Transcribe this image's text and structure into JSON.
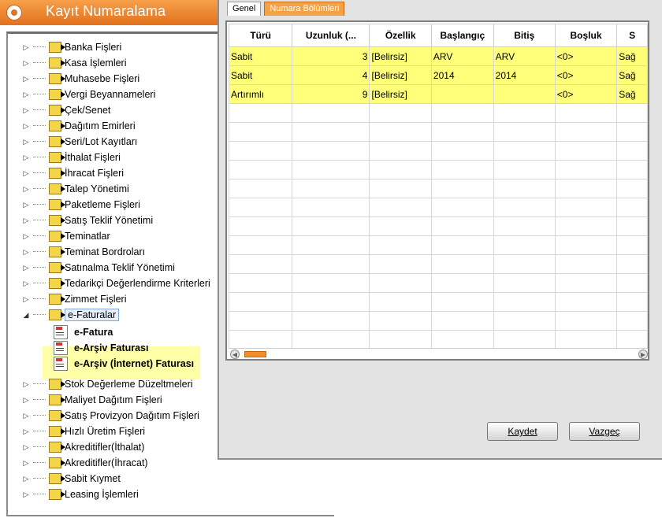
{
  "window": {
    "title": "Kayıt Numaralama"
  },
  "tree": {
    "items": [
      {
        "label": "Banka Fişleri"
      },
      {
        "label": "Kasa İşlemleri"
      },
      {
        "label": "Muhasebe Fişleri"
      },
      {
        "label": "Vergi Beyannameleri"
      },
      {
        "label": "Çek/Senet"
      },
      {
        "label": "Dağıtım Emirleri"
      },
      {
        "label": "Seri/Lot Kayıtları"
      },
      {
        "label": "İthalat Fişleri"
      },
      {
        "label": "İhracat Fişleri"
      },
      {
        "label": "Talep Yönetimi"
      },
      {
        "label": "Paketleme Fişleri"
      },
      {
        "label": "Satış Teklif Yönetimi"
      },
      {
        "label": "Teminatlar"
      },
      {
        "label": "Teminat Bordroları"
      },
      {
        "label": "Satınalma Teklif Yönetimi"
      },
      {
        "label": "Tedarikçi Değerlendirme Kriterleri"
      },
      {
        "label": "Zimmet Fişleri"
      },
      {
        "label": "e-Faturalar"
      },
      {
        "label": "Stok Değerleme Düzeltmeleri"
      },
      {
        "label": "Maliyet Dağıtım Fişleri"
      },
      {
        "label": "Satış Provizyon Dağıtım Fişleri"
      },
      {
        "label": "Hızlı Üretim Fişleri"
      },
      {
        "label": "Akreditifler(İthalat)"
      },
      {
        "label": "Akreditifler(İhracat)"
      },
      {
        "label": "Sabit Kıymet"
      },
      {
        "label": "Leasing İşlemleri"
      }
    ],
    "children": [
      {
        "label": "e-Fatura"
      },
      {
        "label": "e-Arşiv Faturası"
      },
      {
        "label": "e-Arşiv (İnternet) Faturası"
      }
    ]
  },
  "dialog": {
    "tabs": [
      "Genel",
      "Numara Bölümleri"
    ],
    "active_tab": "Numara Bölümleri",
    "grid": {
      "headers": [
        "Türü",
        "Uzunluk (...",
        "Özellik",
        "Başlangıç",
        "Bitiş",
        "Boşluk",
        "S"
      ],
      "rows": [
        [
          "Sabit",
          "3",
          "[Belirsiz]",
          "ARV",
          "ARV",
          "<0>",
          "Sağ"
        ],
        [
          "Sabit",
          "4",
          "[Belirsiz]",
          "2014",
          "2014",
          "<0>",
          "Sağ"
        ],
        [
          "Artırımlı",
          "9",
          "[Belirsiz]",
          "",
          "",
          "<0>",
          "Sağ"
        ]
      ]
    },
    "buttons": {
      "save": "Kaydet",
      "cancel": "Vazgeç"
    }
  },
  "colors": {
    "accent": "#E2711C",
    "highlight": "#FFFF7A"
  }
}
